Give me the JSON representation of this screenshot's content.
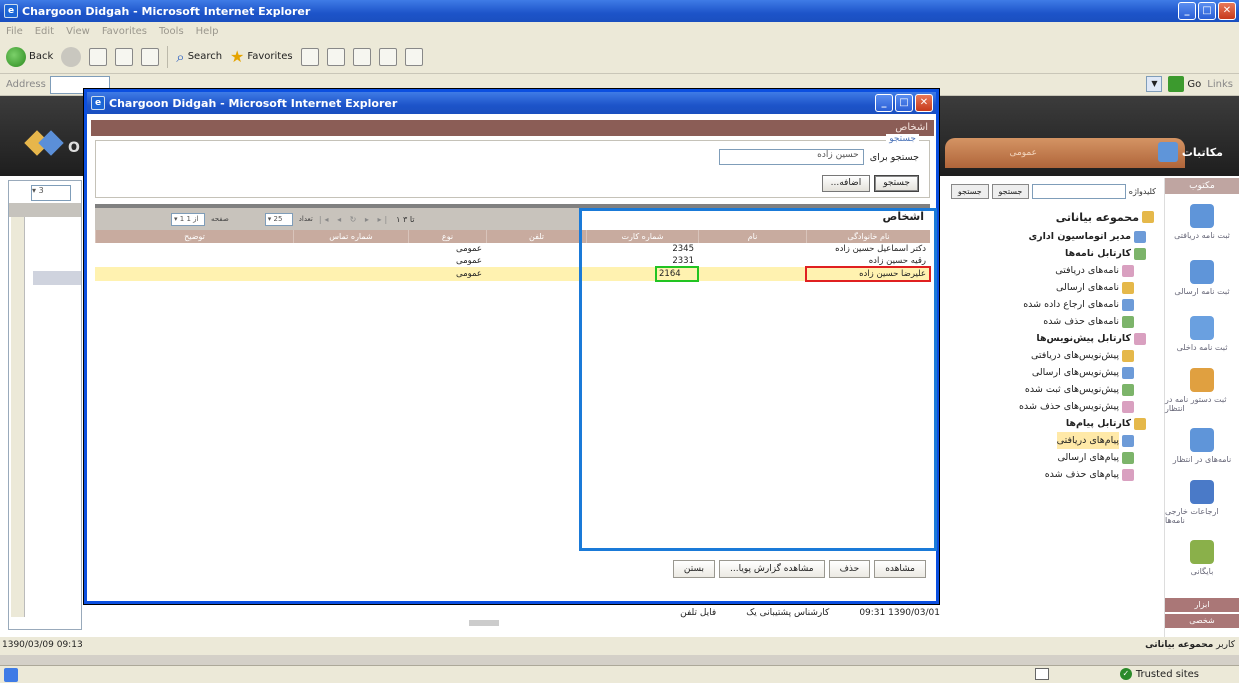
{
  "ie": {
    "title": "Chargoon Didgah - Microsoft Internet Explorer",
    "menu": [
      "File",
      "Edit",
      "View",
      "Favorites",
      "Tools",
      "Help"
    ],
    "toolbar": {
      "back": "Back",
      "search": "Search",
      "favorites": "Favorites"
    },
    "address_label": "Address",
    "go_label": "Go",
    "links_label": "Links",
    "status_zone": "Trusted sites"
  },
  "app": {
    "brand": "O",
    "banner_tab": "عمومی",
    "banner_right": "مکاتبات",
    "left_pane_select": "3",
    "tree_search_label": "کلیدواژه",
    "tree_search_button": "جستجو",
    "tree_search_right_button": "جستجو",
    "tree": [
      {
        "label": "محموعه بیاناتی",
        "level": 0,
        "style": "root"
      },
      {
        "label": "مدیر اتوماسیون اداری",
        "level": 1,
        "style": "bold"
      },
      {
        "label": "کارتابل نامه‌ها",
        "level": 1,
        "style": "bold"
      },
      {
        "label": "نامه‌های دریافتی",
        "level": 2,
        "style": ""
      },
      {
        "label": "نامه‌های ارسالی",
        "level": 2,
        "style": ""
      },
      {
        "label": "نامه‌های ارجاع داده شده",
        "level": 2,
        "style": ""
      },
      {
        "label": "نامه‌های حذف شده",
        "level": 2,
        "style": ""
      },
      {
        "label": "کارتابل پیش‌نویس‌ها",
        "level": 1,
        "style": "bold"
      },
      {
        "label": "پیش‌نویس‌های دریافتی",
        "level": 2,
        "style": ""
      },
      {
        "label": "پیش‌نویس‌های ارسالی",
        "level": 2,
        "style": ""
      },
      {
        "label": "پیش‌نویس‌های ثبت شده",
        "level": 2,
        "style": ""
      },
      {
        "label": "پیش‌نویس‌های حذف شده",
        "level": 2,
        "style": ""
      },
      {
        "label": "کارتابل پیام‌ها",
        "level": 1,
        "style": "bold"
      },
      {
        "label": "پیام‌های دریافتی",
        "level": 2,
        "style": "hl"
      },
      {
        "label": "پیام‌های ارسالی",
        "level": 2,
        "style": ""
      },
      {
        "label": "پیام‌های حذف شده",
        "level": 2,
        "style": ""
      }
    ],
    "vbar": {
      "header": "مکتوب",
      "buttons": [
        "ثبت نامه دریافتی",
        "ثبت نامه ارسالی",
        "ثبت نامه داخلی",
        "ثبت دستور نامه در انتظار",
        "نامه‌های در انتظار",
        "ارجاعات خارجی نامه‌ها",
        "بایگانی"
      ],
      "footer1": "ابزار",
      "footer2": "شخصی"
    },
    "status_time": "1390/03/09 09:13",
    "status_user_label": "کاربر",
    "status_user_name": "محموعه بیاناتی",
    "row_below": {
      "date": "1390/03/01 09:31",
      "sender": "کارشناس پشتیبانی یک",
      "type": "فایل تلفن"
    }
  },
  "popup": {
    "title": "Chargoon Didgah - Microsoft Internet Explorer",
    "section_title": "اشخاص",
    "search_legend": "جستجو",
    "search_label": "جستجو برای",
    "search_value": "حسین زاده",
    "search_button": "جستجو",
    "add_button": "اضافه...",
    "grid_title": "اشخاص",
    "pagination": {
      "range": "۱ تا ۳",
      "per_page_label": "تعداد",
      "per_page": "25",
      "page_label": "صفحه",
      "page": "1 از 1"
    },
    "columns": [
      "نام خانوادگی",
      "نام",
      "شماره کارت",
      "تلفن",
      "نوع",
      "شماره تماس",
      "توضیح"
    ],
    "rows": [
      {
        "name": "دکتر اسماعیل حسین زاده",
        "code": "2345",
        "type": "عمومی"
      },
      {
        "name": "رقیه حسین زاده",
        "code": "2331",
        "type": "عمومی"
      },
      {
        "name": "علیرضا حسین زاده",
        "code": "2164",
        "type": "عمومی"
      }
    ],
    "buttons": [
      "مشاهده",
      "حذف",
      "مشاهده گزارش پویا...",
      "بستن"
    ]
  }
}
